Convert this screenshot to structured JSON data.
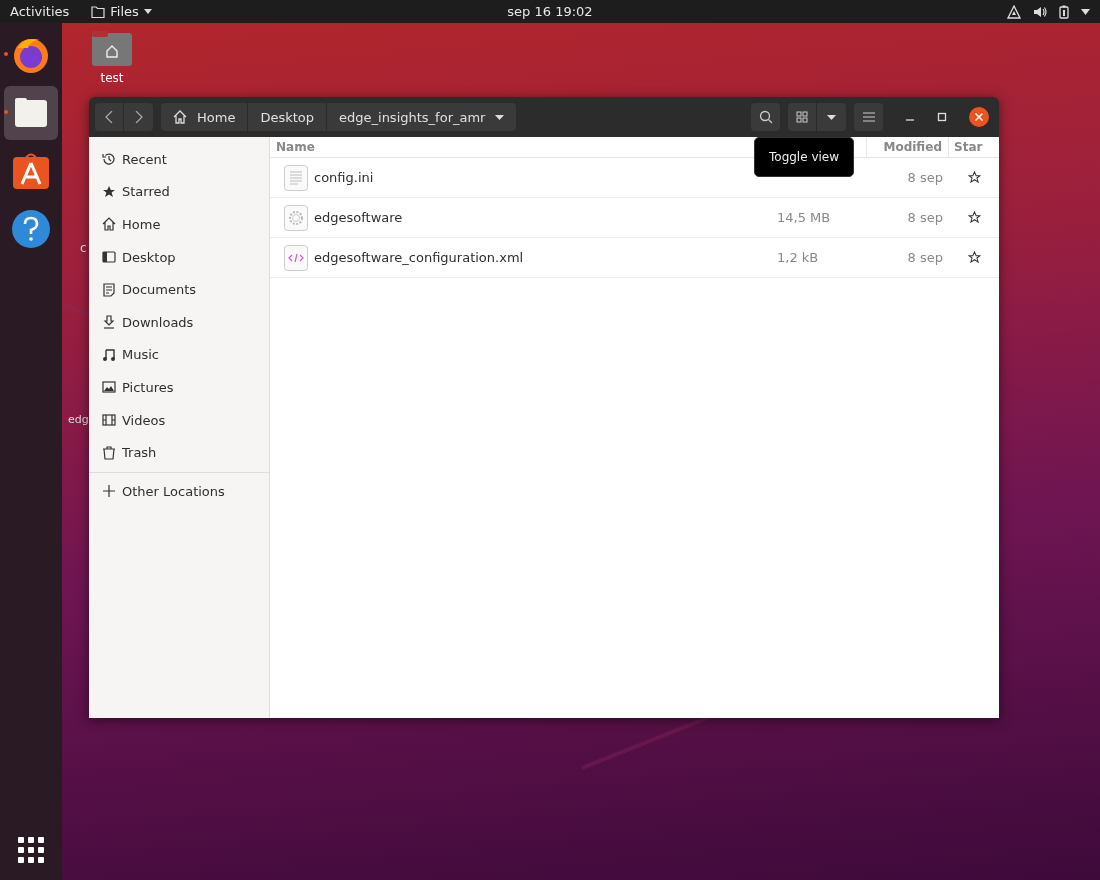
{
  "top_bar": {
    "activities": "Activities",
    "app_menu": "Files",
    "clock": "sep 16  19:02"
  },
  "dock": [
    {
      "kind": "firefox",
      "running": true,
      "selected": false
    },
    {
      "kind": "files",
      "running": true,
      "selected": true
    },
    {
      "kind": "software",
      "running": false,
      "selected": false
    },
    {
      "kind": "help",
      "running": false,
      "selected": false
    }
  ],
  "desktop": {
    "icons": [
      {
        "label": "test"
      }
    ],
    "partial_labels": [
      "c",
      "edg"
    ]
  },
  "window": {
    "breadcrumbs": [
      {
        "label": "Home",
        "kind": "home"
      },
      {
        "label": "Desktop",
        "kind": "folder"
      },
      {
        "label": "edge_insights_for_amr",
        "kind": "current"
      }
    ],
    "sidebar": [
      {
        "label": "Recent",
        "kind": "recent"
      },
      {
        "label": "Starred",
        "kind": "starred"
      },
      {
        "label": "Home",
        "kind": "home"
      },
      {
        "label": "Desktop",
        "kind": "desktop"
      },
      {
        "label": "Documents",
        "kind": "documents"
      },
      {
        "label": "Downloads",
        "kind": "downloads"
      },
      {
        "label": "Music",
        "kind": "music"
      },
      {
        "label": "Pictures",
        "kind": "pictures"
      },
      {
        "label": "Videos",
        "kind": "videos"
      },
      {
        "label": "Trash",
        "kind": "trash"
      }
    ],
    "other_locations": "Other Locations",
    "columns": {
      "name": "Name",
      "modified": "Modified",
      "star": "Star"
    },
    "rows": [
      {
        "name": "config.ini",
        "kind": "text",
        "modified": "8 sep",
        "starred": false
      },
      {
        "name": "edgesoftware",
        "kind": "executable",
        "size": "14,5 MB",
        "modified": "8 sep",
        "starred": false
      },
      {
        "name": "edgesoftware_configuration.xml",
        "kind": "xml",
        "size": "1,2 kB",
        "modified": "8 sep",
        "starred": false
      }
    ],
    "tooltip": "Toggle view"
  }
}
